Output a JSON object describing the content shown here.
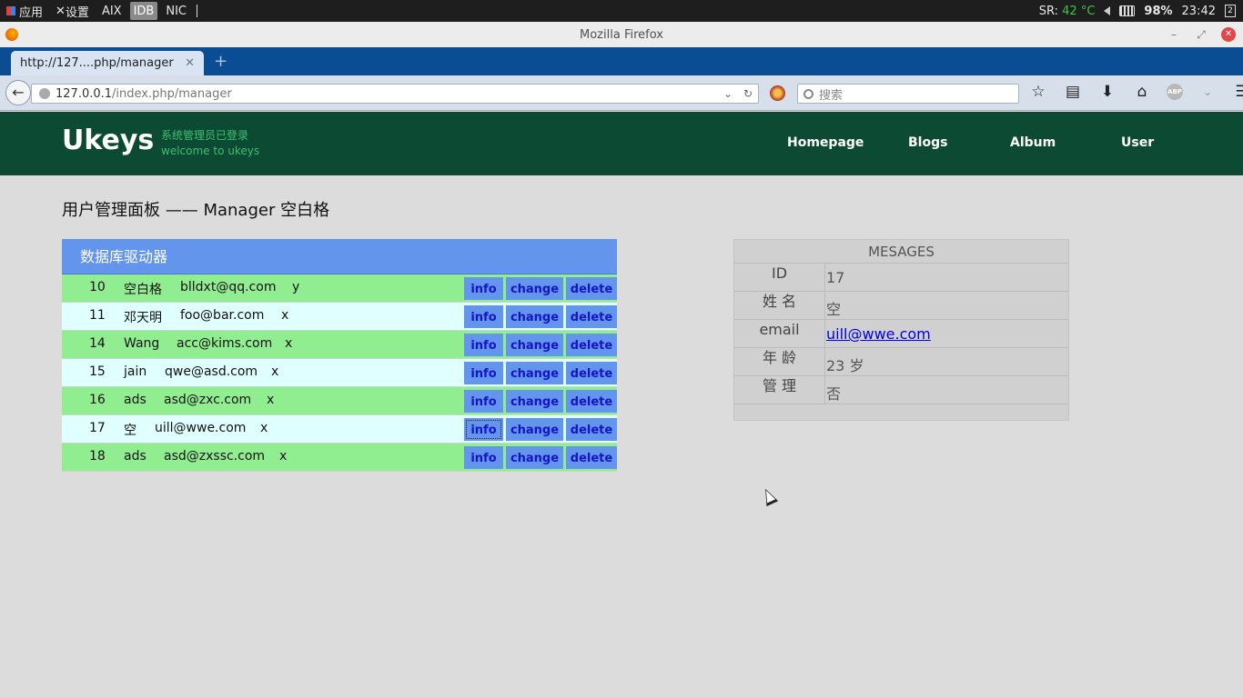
{
  "system_bar": {
    "menu_items": [
      "应用",
      "设置",
      "AIX",
      "IDB",
      "NIC"
    ],
    "active_item": "IDB",
    "sensor_label": "SR:",
    "temperature": "42 °C",
    "battery": "98%",
    "time": "23:42",
    "workspace": "2"
  },
  "window": {
    "title": "Mozilla Firefox"
  },
  "browser": {
    "tab_title": "http://127....php/manager",
    "url_host": "127.0.0.1",
    "url_path": "/index.php/manager",
    "search_placeholder": "搜索",
    "abp_label": "ABP"
  },
  "site": {
    "logo": "Ukeys",
    "status_line": "系统管理员已登录",
    "welcome_line": "welcome to ukeys",
    "nav": [
      "Homepage",
      "Blogs",
      "Album",
      "User"
    ]
  },
  "page": {
    "title": "用户管理面板 —— Manager 空白格"
  },
  "users_panel": {
    "heading": "数据库驱动器",
    "buttons": {
      "info": "info",
      "change": "change",
      "delete": "delete"
    },
    "rows": [
      {
        "id": "10",
        "name": "空白格",
        "email": "blldxt@qq.com",
        "admin": "y"
      },
      {
        "id": "11",
        "name": "邓天明",
        "email": "foo@bar.com",
        "admin": "x"
      },
      {
        "id": "14",
        "name": "Wang",
        "email": "acc@kims.com",
        "admin": "x"
      },
      {
        "id": "15",
        "name": "jain",
        "email": "qwe@asd.com",
        "admin": "x"
      },
      {
        "id": "16",
        "name": "ads",
        "email": "asd@zxc.com",
        "admin": "x"
      },
      {
        "id": "17",
        "name": "空",
        "email": "uill@wwe.com",
        "admin": "x"
      },
      {
        "id": "18",
        "name": "ads",
        "email": "asd@zxssc.com",
        "admin": "x"
      }
    ]
  },
  "messages": {
    "heading": "MESAGES",
    "fields": [
      {
        "label": "ID",
        "value": "17"
      },
      {
        "label": "姓 名",
        "value": "空"
      },
      {
        "label": "email",
        "value": "uill@wwe.com"
      },
      {
        "label": "年 龄",
        "value": "23 岁"
      },
      {
        "label": "管 理",
        "value": "否"
      }
    ]
  }
}
